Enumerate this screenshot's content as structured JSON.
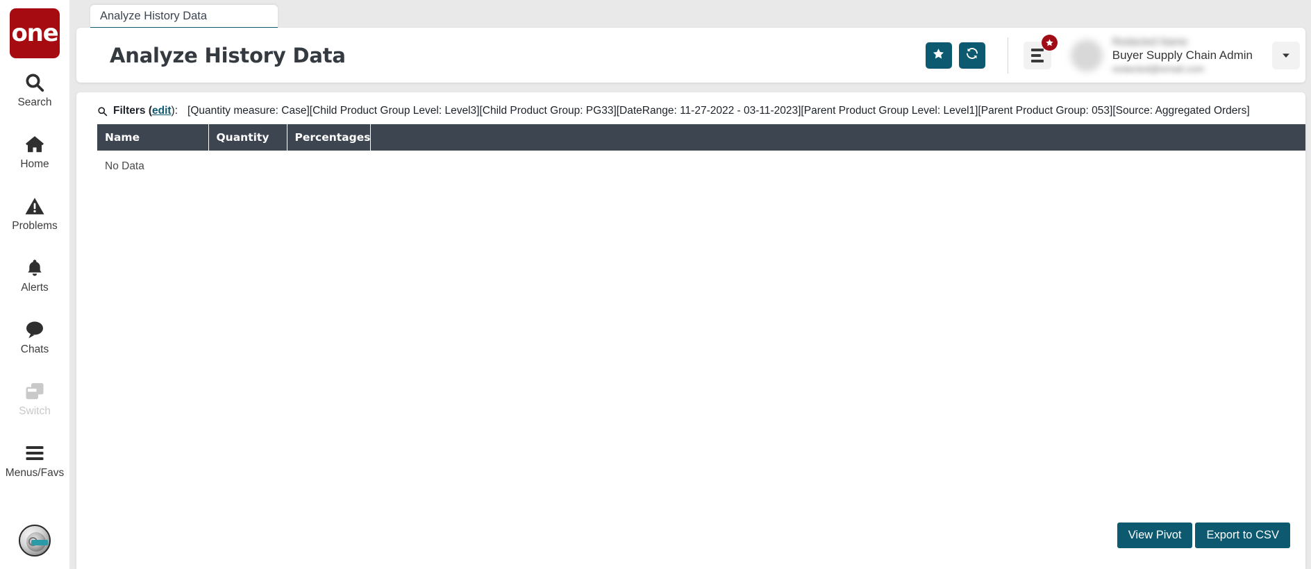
{
  "brand": {
    "logo_text": "one",
    "logo_color": "#a50b10"
  },
  "theme": {
    "accent": "#0d5a70",
    "table_header_bg": "#3d4551",
    "badge_red": "#a00c16"
  },
  "sidebar": {
    "items": [
      {
        "label": "Search",
        "icon": "search-icon",
        "disabled": false
      },
      {
        "label": "Home",
        "icon": "home-icon",
        "disabled": false
      },
      {
        "label": "Problems",
        "icon": "warning-icon",
        "disabled": false
      },
      {
        "label": "Alerts",
        "icon": "bell-icon",
        "disabled": false
      },
      {
        "label": "Chats",
        "icon": "chat-icon",
        "disabled": false
      },
      {
        "label": "Switch",
        "icon": "switch-icon",
        "disabled": true
      },
      {
        "label": "Menus/Favs",
        "icon": "hamburger-icon",
        "disabled": false
      }
    ],
    "bottom_avatar_icon": "assistant-avatar-icon"
  },
  "tabs": [
    {
      "label": "Analyze History Data",
      "active": true
    }
  ],
  "header": {
    "title": "Analyze History Data",
    "favorite_button_icon": "star-icon",
    "refresh_button_icon": "refresh-icon",
    "menus_button_icon": "menu-lines-icon",
    "menus_badge_icon": "star-icon",
    "caret_icon": "chevron-down-icon",
    "user": {
      "name": "",
      "role": "Buyer Supply Chain Admin",
      "email": ""
    }
  },
  "filters": {
    "search_icon": "search-icon",
    "label": "Filters (",
    "edit_link": "edit",
    "label_suffix": "):",
    "value": "[Quantity measure: Case][Child Product Group Level: Level3][Child Product Group: PG33][DateRange: 11-27-2022 - 03-11-2023][Parent Product Group Level: Level1][Parent Product Group: 053][Source: Aggregated Orders]"
  },
  "table": {
    "columns": [
      "Name",
      "Quantity",
      "Percentages",
      ""
    ],
    "rows": [],
    "empty_text": "No Data"
  },
  "footer": {
    "view_pivot_label": "View Pivot",
    "export_csv_label": "Export to CSV"
  }
}
